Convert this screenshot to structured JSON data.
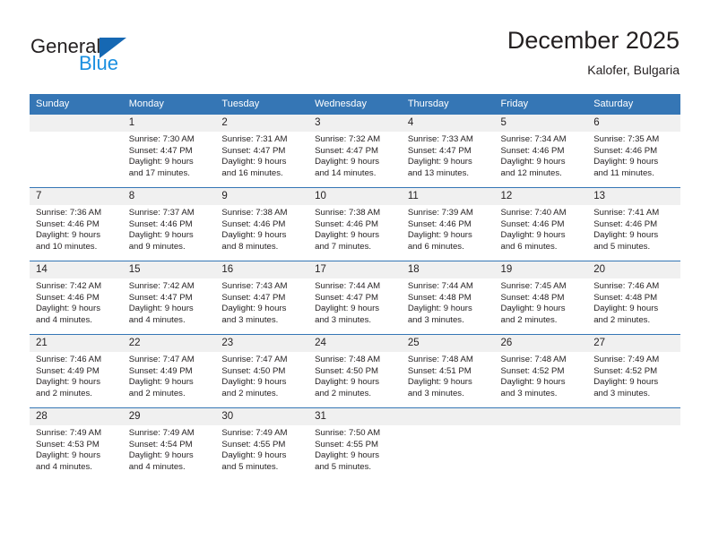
{
  "brand": {
    "name_part1": "General",
    "name_part2": "Blue",
    "triangle_icon": "triangle-icon",
    "primary_color": "#1668b3",
    "secondary_color": "#1a8fe0"
  },
  "header": {
    "title": "December 2025",
    "subtitle": "Kalofer, Bulgaria"
  },
  "calendar": {
    "header_bg": "#3576b5",
    "header_text_color": "#ffffff",
    "daynum_bg": "#f0f0f0",
    "weekdays": [
      "Sunday",
      "Monday",
      "Tuesday",
      "Wednesday",
      "Thursday",
      "Friday",
      "Saturday"
    ],
    "weeks": [
      [
        {
          "day": "",
          "sunrise": "",
          "sunset": "",
          "daylight1": "",
          "daylight2": "",
          "blank": true
        },
        {
          "day": "1",
          "sunrise": "Sunrise: 7:30 AM",
          "sunset": "Sunset: 4:47 PM",
          "daylight1": "Daylight: 9 hours",
          "daylight2": "and 17 minutes."
        },
        {
          "day": "2",
          "sunrise": "Sunrise: 7:31 AM",
          "sunset": "Sunset: 4:47 PM",
          "daylight1": "Daylight: 9 hours",
          "daylight2": "and 16 minutes."
        },
        {
          "day": "3",
          "sunrise": "Sunrise: 7:32 AM",
          "sunset": "Sunset: 4:47 PM",
          "daylight1": "Daylight: 9 hours",
          "daylight2": "and 14 minutes."
        },
        {
          "day": "4",
          "sunrise": "Sunrise: 7:33 AM",
          "sunset": "Sunset: 4:47 PM",
          "daylight1": "Daylight: 9 hours",
          "daylight2": "and 13 minutes."
        },
        {
          "day": "5",
          "sunrise": "Sunrise: 7:34 AM",
          "sunset": "Sunset: 4:46 PM",
          "daylight1": "Daylight: 9 hours",
          "daylight2": "and 12 minutes."
        },
        {
          "day": "6",
          "sunrise": "Sunrise: 7:35 AM",
          "sunset": "Sunset: 4:46 PM",
          "daylight1": "Daylight: 9 hours",
          "daylight2": "and 11 minutes."
        }
      ],
      [
        {
          "day": "7",
          "sunrise": "Sunrise: 7:36 AM",
          "sunset": "Sunset: 4:46 PM",
          "daylight1": "Daylight: 9 hours",
          "daylight2": "and 10 minutes."
        },
        {
          "day": "8",
          "sunrise": "Sunrise: 7:37 AM",
          "sunset": "Sunset: 4:46 PM",
          "daylight1": "Daylight: 9 hours",
          "daylight2": "and 9 minutes."
        },
        {
          "day": "9",
          "sunrise": "Sunrise: 7:38 AM",
          "sunset": "Sunset: 4:46 PM",
          "daylight1": "Daylight: 9 hours",
          "daylight2": "and 8 minutes."
        },
        {
          "day": "10",
          "sunrise": "Sunrise: 7:38 AM",
          "sunset": "Sunset: 4:46 PM",
          "daylight1": "Daylight: 9 hours",
          "daylight2": "and 7 minutes."
        },
        {
          "day": "11",
          "sunrise": "Sunrise: 7:39 AM",
          "sunset": "Sunset: 4:46 PM",
          "daylight1": "Daylight: 9 hours",
          "daylight2": "and 6 minutes."
        },
        {
          "day": "12",
          "sunrise": "Sunrise: 7:40 AM",
          "sunset": "Sunset: 4:46 PM",
          "daylight1": "Daylight: 9 hours",
          "daylight2": "and 6 minutes."
        },
        {
          "day": "13",
          "sunrise": "Sunrise: 7:41 AM",
          "sunset": "Sunset: 4:46 PM",
          "daylight1": "Daylight: 9 hours",
          "daylight2": "and 5 minutes."
        }
      ],
      [
        {
          "day": "14",
          "sunrise": "Sunrise: 7:42 AM",
          "sunset": "Sunset: 4:46 PM",
          "daylight1": "Daylight: 9 hours",
          "daylight2": "and 4 minutes."
        },
        {
          "day": "15",
          "sunrise": "Sunrise: 7:42 AM",
          "sunset": "Sunset: 4:47 PM",
          "daylight1": "Daylight: 9 hours",
          "daylight2": "and 4 minutes."
        },
        {
          "day": "16",
          "sunrise": "Sunrise: 7:43 AM",
          "sunset": "Sunset: 4:47 PM",
          "daylight1": "Daylight: 9 hours",
          "daylight2": "and 3 minutes."
        },
        {
          "day": "17",
          "sunrise": "Sunrise: 7:44 AM",
          "sunset": "Sunset: 4:47 PM",
          "daylight1": "Daylight: 9 hours",
          "daylight2": "and 3 minutes."
        },
        {
          "day": "18",
          "sunrise": "Sunrise: 7:44 AM",
          "sunset": "Sunset: 4:48 PM",
          "daylight1": "Daylight: 9 hours",
          "daylight2": "and 3 minutes."
        },
        {
          "day": "19",
          "sunrise": "Sunrise: 7:45 AM",
          "sunset": "Sunset: 4:48 PM",
          "daylight1": "Daylight: 9 hours",
          "daylight2": "and 2 minutes."
        },
        {
          "day": "20",
          "sunrise": "Sunrise: 7:46 AM",
          "sunset": "Sunset: 4:48 PM",
          "daylight1": "Daylight: 9 hours",
          "daylight2": "and 2 minutes."
        }
      ],
      [
        {
          "day": "21",
          "sunrise": "Sunrise: 7:46 AM",
          "sunset": "Sunset: 4:49 PM",
          "daylight1": "Daylight: 9 hours",
          "daylight2": "and 2 minutes."
        },
        {
          "day": "22",
          "sunrise": "Sunrise: 7:47 AM",
          "sunset": "Sunset: 4:49 PM",
          "daylight1": "Daylight: 9 hours",
          "daylight2": "and 2 minutes."
        },
        {
          "day": "23",
          "sunrise": "Sunrise: 7:47 AM",
          "sunset": "Sunset: 4:50 PM",
          "daylight1": "Daylight: 9 hours",
          "daylight2": "and 2 minutes."
        },
        {
          "day": "24",
          "sunrise": "Sunrise: 7:48 AM",
          "sunset": "Sunset: 4:50 PM",
          "daylight1": "Daylight: 9 hours",
          "daylight2": "and 2 minutes."
        },
        {
          "day": "25",
          "sunrise": "Sunrise: 7:48 AM",
          "sunset": "Sunset: 4:51 PM",
          "daylight1": "Daylight: 9 hours",
          "daylight2": "and 3 minutes."
        },
        {
          "day": "26",
          "sunrise": "Sunrise: 7:48 AM",
          "sunset": "Sunset: 4:52 PM",
          "daylight1": "Daylight: 9 hours",
          "daylight2": "and 3 minutes."
        },
        {
          "day": "27",
          "sunrise": "Sunrise: 7:49 AM",
          "sunset": "Sunset: 4:52 PM",
          "daylight1": "Daylight: 9 hours",
          "daylight2": "and 3 minutes."
        }
      ],
      [
        {
          "day": "28",
          "sunrise": "Sunrise: 7:49 AM",
          "sunset": "Sunset: 4:53 PM",
          "daylight1": "Daylight: 9 hours",
          "daylight2": "and 4 minutes."
        },
        {
          "day": "29",
          "sunrise": "Sunrise: 7:49 AM",
          "sunset": "Sunset: 4:54 PM",
          "daylight1": "Daylight: 9 hours",
          "daylight2": "and 4 minutes."
        },
        {
          "day": "30",
          "sunrise": "Sunrise: 7:49 AM",
          "sunset": "Sunset: 4:55 PM",
          "daylight1": "Daylight: 9 hours",
          "daylight2": "and 5 minutes."
        },
        {
          "day": "31",
          "sunrise": "Sunrise: 7:50 AM",
          "sunset": "Sunset: 4:55 PM",
          "daylight1": "Daylight: 9 hours",
          "daylight2": "and 5 minutes."
        },
        {
          "day": "",
          "sunrise": "",
          "sunset": "",
          "daylight1": "",
          "daylight2": "",
          "blank": true
        },
        {
          "day": "",
          "sunrise": "",
          "sunset": "",
          "daylight1": "",
          "daylight2": "",
          "blank": true
        },
        {
          "day": "",
          "sunrise": "",
          "sunset": "",
          "daylight1": "",
          "daylight2": "",
          "blank": true
        }
      ]
    ]
  }
}
